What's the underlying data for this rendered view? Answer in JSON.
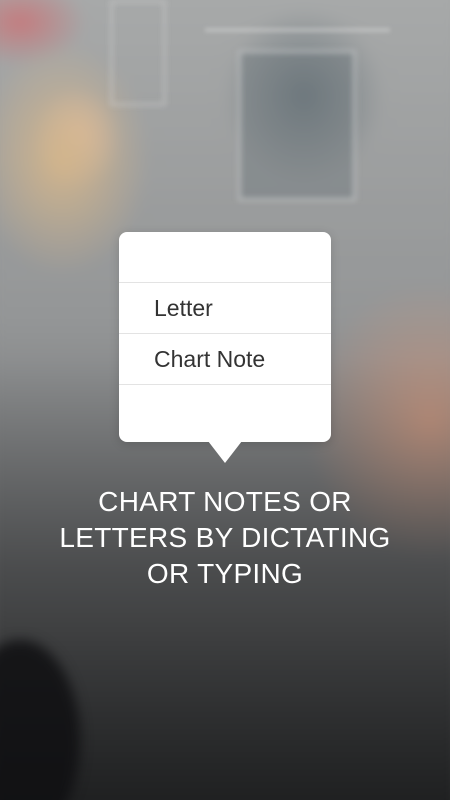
{
  "menu": {
    "items": [
      {
        "label": "Letter"
      },
      {
        "label": "Chart Note"
      }
    ]
  },
  "caption": {
    "lines": [
      "CHART NOTES OR",
      "LETTERS BY DICTATING",
      "OR TYPING"
    ]
  },
  "colors": {
    "popover_bg": "#ffffff",
    "menu_text": "#333333",
    "caption_text": "#ffffff",
    "divider": "#e3e3e3"
  }
}
